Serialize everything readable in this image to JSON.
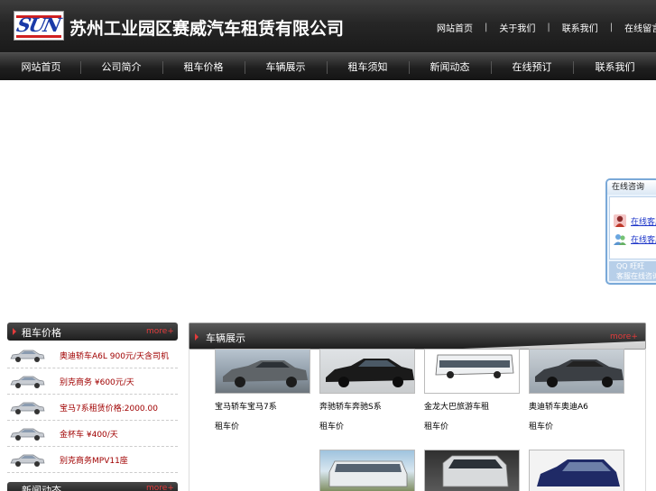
{
  "header": {
    "logo_text": "SUN",
    "company_name": "苏州工业园区赛威汽车租赁有限公司",
    "top_links": [
      "网站首页",
      "关于我们",
      "联系我们",
      "在线留言"
    ]
  },
  "nav": {
    "items": [
      "网站首页",
      "公司简介",
      "租车价格",
      "车辆展示",
      "租车须知",
      "新闻动态",
      "在线预订",
      "联系我们"
    ]
  },
  "consult": {
    "title": "在线咨询",
    "links": [
      "在线客服",
      "在线客服"
    ],
    "footer_line1": "QQ 旺旺",
    "footer_line2": "客服在线咨询"
  },
  "left_panel": {
    "title": "租车价格",
    "more": "more+",
    "items": [
      "奥迪轿车A6L 900元/天含司机",
      "别克商务 ¥600元/天",
      "宝马7系租赁价格:2000.00",
      "金杯车 ¥400/天",
      "别克商务MPV11座"
    ],
    "second_title": "新闻动态",
    "second_more": "more+"
  },
  "main_panel": {
    "title": "车辆展示",
    "more": "more+",
    "row1": [
      {
        "caption": "宝马轿车宝马7系",
        "sub": "租车价"
      },
      {
        "caption": "奔驰轿车奔驰S系",
        "sub": "租车价"
      },
      {
        "caption": "金龙大巴旅游车租",
        "sub": "租车价"
      },
      {
        "caption": "奥迪轿车奥迪A6",
        "sub": "租车价"
      }
    ]
  },
  "colors": {
    "accent_red": "#e23b3b",
    "header_dark": "#262626",
    "link_blue": "#1a33c8"
  }
}
